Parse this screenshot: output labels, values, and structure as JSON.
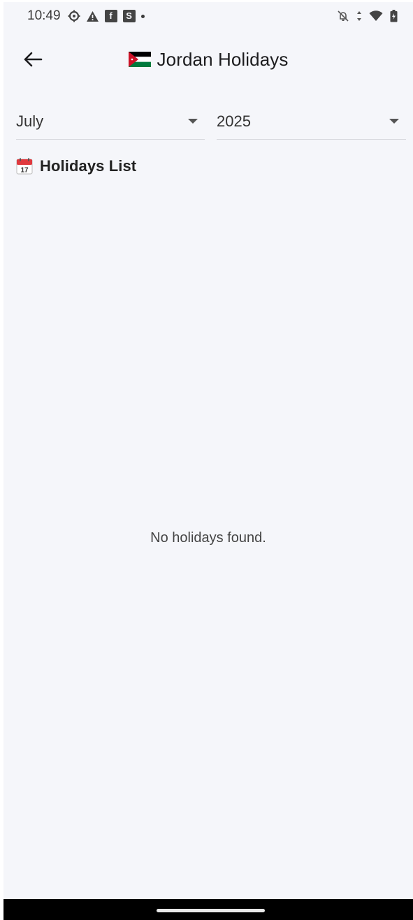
{
  "status_bar": {
    "time": "10:49",
    "notification_icons": [
      "gear-icon",
      "warning-icon",
      "facebook-icon",
      "s-app-icon"
    ],
    "s_app_letter": "S",
    "facebook_letter": "f",
    "system_icons": [
      "alarm-off-icon",
      "data-arrows-icon",
      "wifi-icon",
      "battery-icon"
    ]
  },
  "app_bar": {
    "title": "Jordan Holidays",
    "flag": "jordan-flag"
  },
  "filters": {
    "month": "July",
    "year": "2025"
  },
  "section": {
    "title": "Holidays List",
    "icon": "calendar-icon",
    "calendar_day": "17"
  },
  "empty_state": {
    "message": "No holidays found."
  },
  "colors": {
    "background": "#f5f6fa",
    "text": "#1c1c1e",
    "divider": "#d7d8de",
    "nav_bar": "#000000",
    "flag_black": "#000000",
    "flag_white": "#ffffff",
    "flag_green": "#007a3d",
    "flag_red": "#ce1126"
  }
}
